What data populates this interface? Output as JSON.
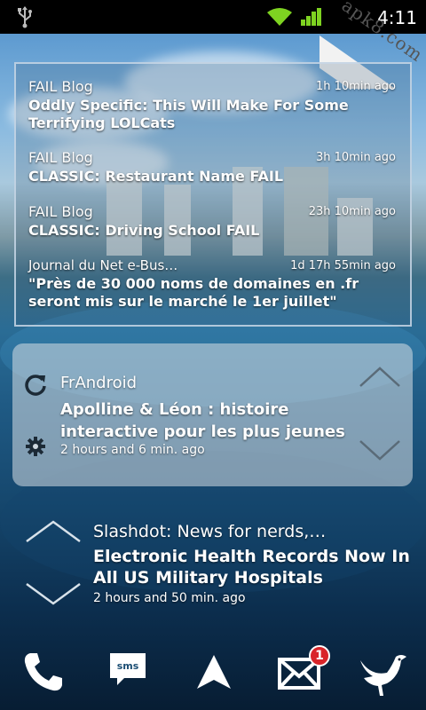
{
  "status_bar": {
    "time": "4:11",
    "watermark": "apk8.com",
    "icons": [
      "usb-icon",
      "wifi-icon",
      "signal-icon"
    ]
  },
  "feed_widget_1": {
    "items": [
      {
        "source": "FAIL Blog",
        "time": "1h 10min ago",
        "title": "Oddly Specific: This Will Make For Some Terrifying LOLCats"
      },
      {
        "source": "FAIL Blog",
        "time": "3h 10min ago",
        "title": "CLASSIC: Restaurant Name FAIL"
      },
      {
        "source": "FAIL Blog",
        "time": "23h 10min ago",
        "title": "CLASSIC: Driving School FAIL"
      },
      {
        "source": "Journal du Net e-Bus…",
        "time": "1d 17h 55min ago",
        "title": "\"Près de 30 000 noms de domaines en .fr seront mis sur le marché le 1er juillet\""
      }
    ]
  },
  "feed_widget_2": {
    "source": "FrAndroid",
    "title": "Apolline & Léon : histoire interactive pour les plus jeunes",
    "time": "2 hours and 6 min. ago"
  },
  "feed_widget_3": {
    "source": "Slashdot: News for nerds,…",
    "title": "Electronic Health Records Now In All US Military Hospitals",
    "time": "2 hours and 50 min. ago"
  },
  "dock": {
    "items": [
      "phone-icon",
      "sms-icon",
      "app-drawer-icon",
      "email-icon",
      "twitter-bird-icon"
    ],
    "sms_label": "sms",
    "email_badge": "1"
  },
  "colors": {
    "badge": "#d9252a",
    "status_bar": "#000000"
  }
}
